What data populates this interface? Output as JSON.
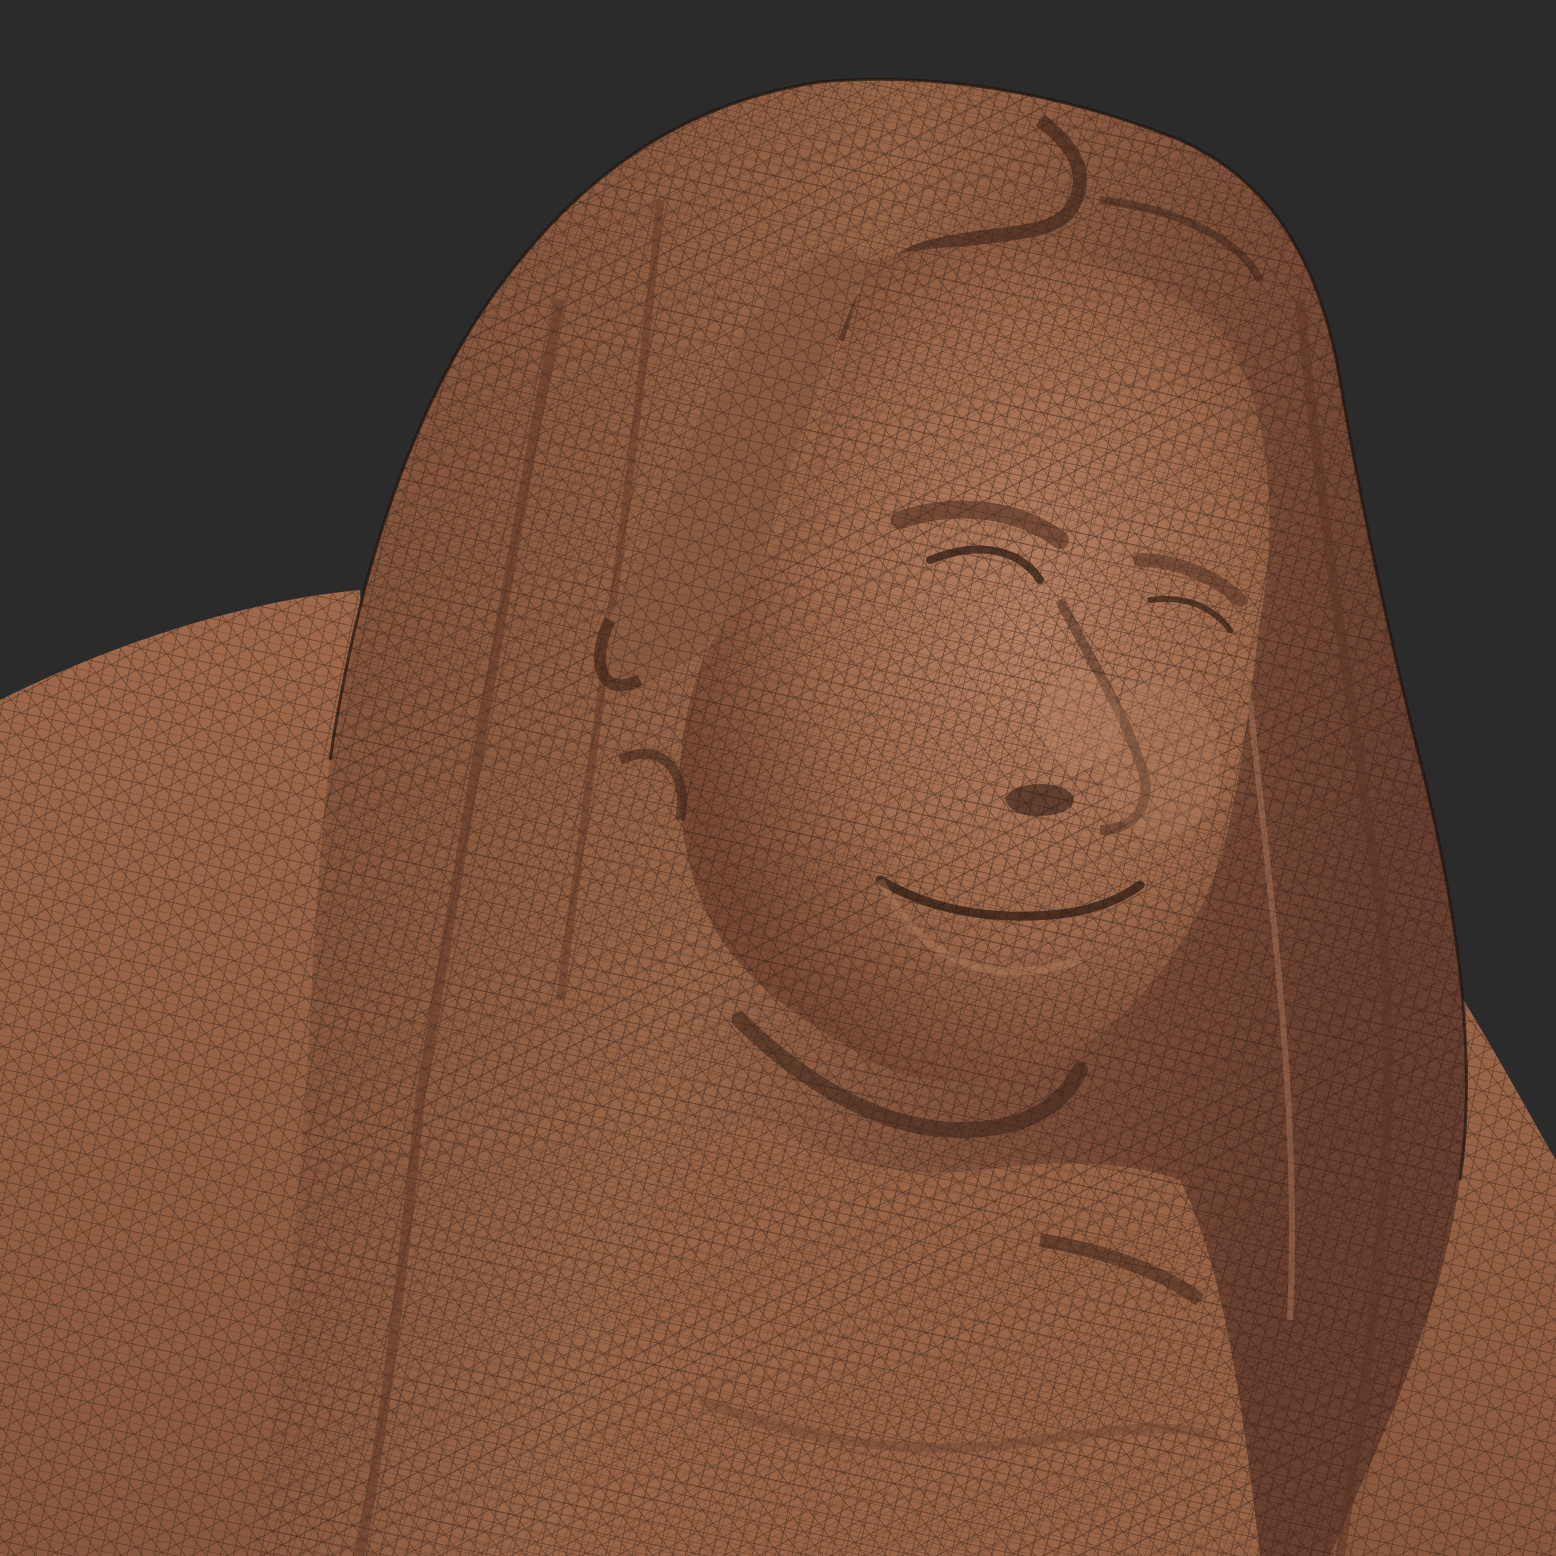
{
  "scene": {
    "background_color": "#2b2b2b",
    "material_color": "#a06a4c",
    "material_shadow": "#4a2c1f",
    "material_highlight": "#c08a6a",
    "wire_color": "#2a1a12"
  },
  "render": {
    "display": "wireframe-on-shaded",
    "subject": "mesh-bust-sculpt"
  }
}
